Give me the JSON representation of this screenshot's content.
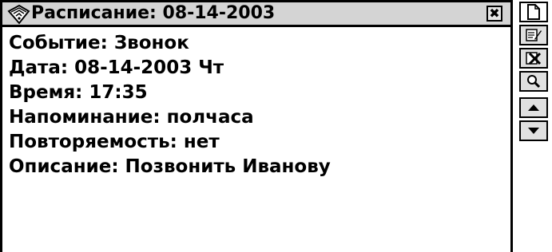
{
  "window": {
    "title": "Расписание: 08-14-2003",
    "close_symbol": "✖"
  },
  "event": {
    "fields": [
      {
        "label": "Событие:",
        "value": "Звонок"
      },
      {
        "label": "Дата:",
        "value": "08-14-2003 Чт"
      },
      {
        "label": "Время:",
        "value": "17:35"
      },
      {
        "label": "Напоминание:",
        "value": "полчаса"
      },
      {
        "label": "Повторяемость:",
        "value": "нет"
      },
      {
        "label": "Описание:",
        "value": "Позвонить Иванову"
      }
    ]
  },
  "toolbar": {
    "buttons": [
      {
        "icon": "new-document-icon"
      },
      {
        "icon": "edit-icon"
      },
      {
        "icon": "delete-icon"
      },
      {
        "icon": "search-icon"
      },
      {
        "icon": "scroll-up-icon"
      },
      {
        "icon": "scroll-down-icon"
      }
    ]
  },
  "colors": {
    "titlebar": "#d4d4d4",
    "border": "#000000",
    "button_face": "#e0e0e0"
  }
}
